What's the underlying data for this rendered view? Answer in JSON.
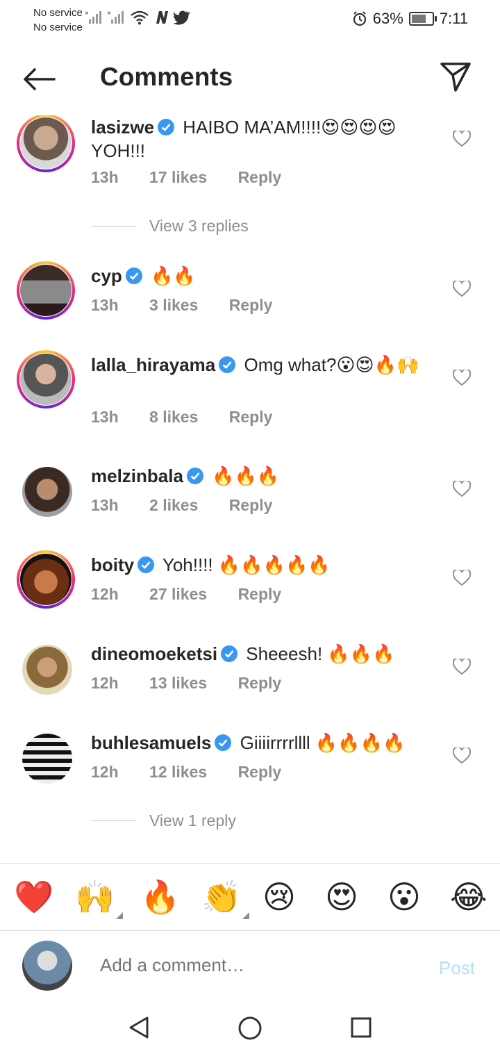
{
  "status_bar": {
    "carrier_1": "No service",
    "carrier_2": "No service",
    "battery": "63%",
    "time": "7:11",
    "icons": [
      "signal-icon",
      "wifi-icon",
      "n-app-icon",
      "twitter-icon",
      "alarm-icon",
      "battery-icon"
    ]
  },
  "header": {
    "title": "Comments",
    "back_icon": "back-arrow-icon",
    "send_icon": "send-icon"
  },
  "comments": [
    {
      "username": "lasizwe",
      "verified": true,
      "text": "HAIBO MA’AM!!!!😍😍😍😍 YOH!!!",
      "time": "13h",
      "likes": "17 likes",
      "reply": "Reply"
    },
    {
      "username": "cyp",
      "verified": true,
      "text": "🔥🔥",
      "time": "13h",
      "likes": "3 likes",
      "reply": "Reply"
    },
    {
      "username": "lalla_hirayama",
      "verified": true,
      "text": "Omg what?😮😍🔥🙌",
      "time": "13h",
      "likes": "8 likes",
      "reply": "Reply"
    },
    {
      "username": "melzinbala",
      "verified": true,
      "text": "🔥🔥🔥",
      "time": "13h",
      "likes": "2 likes",
      "reply": "Reply"
    },
    {
      "username": "boity",
      "verified": true,
      "text": "Yoh!!!! 🔥🔥🔥🔥🔥",
      "time": "12h",
      "likes": "27 likes",
      "reply": "Reply"
    },
    {
      "username": "dineomoeketsi",
      "verified": true,
      "text": "Sheeesh! 🔥🔥🔥",
      "time": "12h",
      "likes": "13 likes",
      "reply": "Reply"
    },
    {
      "username": "buhlesamuels",
      "verified": true,
      "text": "Giiiirrrrllll 🔥🔥🔥🔥",
      "time": "12h",
      "likes": "12 likes",
      "reply": "Reply"
    }
  ],
  "view_replies": [
    "View 3 replies",
    "View 1 reply"
  ],
  "emoji_bar": [
    "❤️",
    "🙌",
    "🔥",
    "👏",
    "😢",
    "😍",
    "😮",
    "😂"
  ],
  "compose": {
    "placeholder": "Add a comment…",
    "post_label": "Post"
  },
  "nav": {
    "back_icon": "nav-back-icon",
    "home_icon": "nav-home-icon",
    "recents_icon": "nav-recents-icon"
  },
  "colors": {
    "link_blue": "#0095f6",
    "post_disabled": "#b2dffc",
    "meta_gray": "#8e8e8e",
    "verified_blue": "#3897f0"
  }
}
